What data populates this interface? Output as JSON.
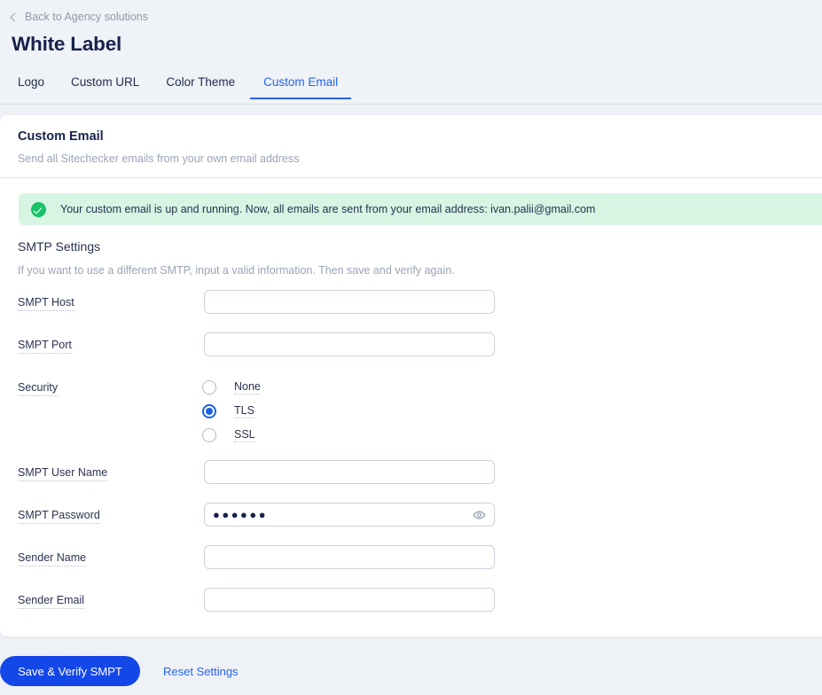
{
  "header": {
    "back_link": "Back to Agency solutions",
    "title": "White Label",
    "tabs": [
      {
        "label": "Logo",
        "active": false
      },
      {
        "label": "Custom URL",
        "active": false
      },
      {
        "label": "Color Theme",
        "active": false
      },
      {
        "label": "Custom Email",
        "active": true
      }
    ]
  },
  "card": {
    "title": "Custom Email",
    "subtitle": "Send all Sitechecker emails from your own email address"
  },
  "alert": {
    "icon": "check-circle-icon",
    "text": "Your custom email is up and running. Now, all emails are sent from your email address: ivan.palii@gmail.com",
    "background": "#d6f5e3",
    "icon_color": "#19c268"
  },
  "smtp": {
    "section_title": "SMTP Settings",
    "section_desc": "If you want to use a different SMTP, input a valid information. Then save and verify again.",
    "fields": {
      "host_label": "SMPT Host",
      "host_value": "",
      "port_label": "SMPT Port",
      "port_value": "",
      "security_label": "Security",
      "security_options": [
        "None",
        "TLS",
        "SSL"
      ],
      "security_selected": "TLS",
      "username_label": "SMPT User Name",
      "username_value": "",
      "password_label": "SMPT Password",
      "password_masked": "●●●●●●",
      "password_toggle_icon": "eye-icon",
      "sender_name_label": "Sender Name",
      "sender_name_value": "",
      "sender_email_label": "Sender Email",
      "sender_email_value": ""
    }
  },
  "footer": {
    "save_label": "Save & Verify SMPT",
    "reset_label": "Reset Settings",
    "primary_color": "#1347e8",
    "link_color": "#2563f5"
  }
}
